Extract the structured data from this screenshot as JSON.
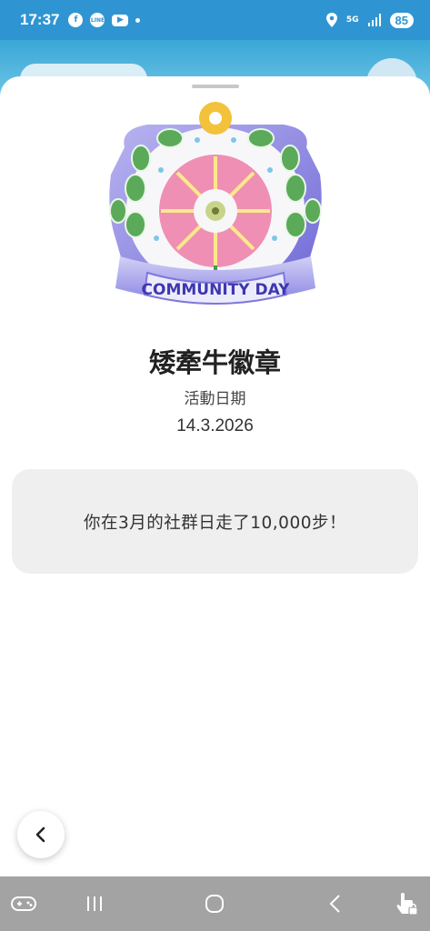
{
  "status_bar": {
    "time": "17:37",
    "network": "5G",
    "battery": "85"
  },
  "sheet": {
    "badge_banner_text": "COMMUNITY DAY",
    "badge_title": "矮牽牛徽章",
    "event_label": "活動日期",
    "event_date": "14.3.2026",
    "message": "你在3月的社群日走了10,000步！"
  },
  "icons": {
    "facebook": "facebook-icon",
    "line": "line-icon",
    "youtube": "youtube-icon",
    "location": "location-icon",
    "signal": "signal-icon",
    "back": "chevron-left-icon",
    "nav_game": "gamepad-icon",
    "nav_recents": "recents-icon",
    "nav_home": "home-icon",
    "nav_back": "back-icon",
    "nav_touch": "touch-lock-icon"
  },
  "colors": {
    "status_bar": "#2f95d2",
    "card_bg": "#efefef",
    "nav_bar": "#a3a3a3"
  }
}
